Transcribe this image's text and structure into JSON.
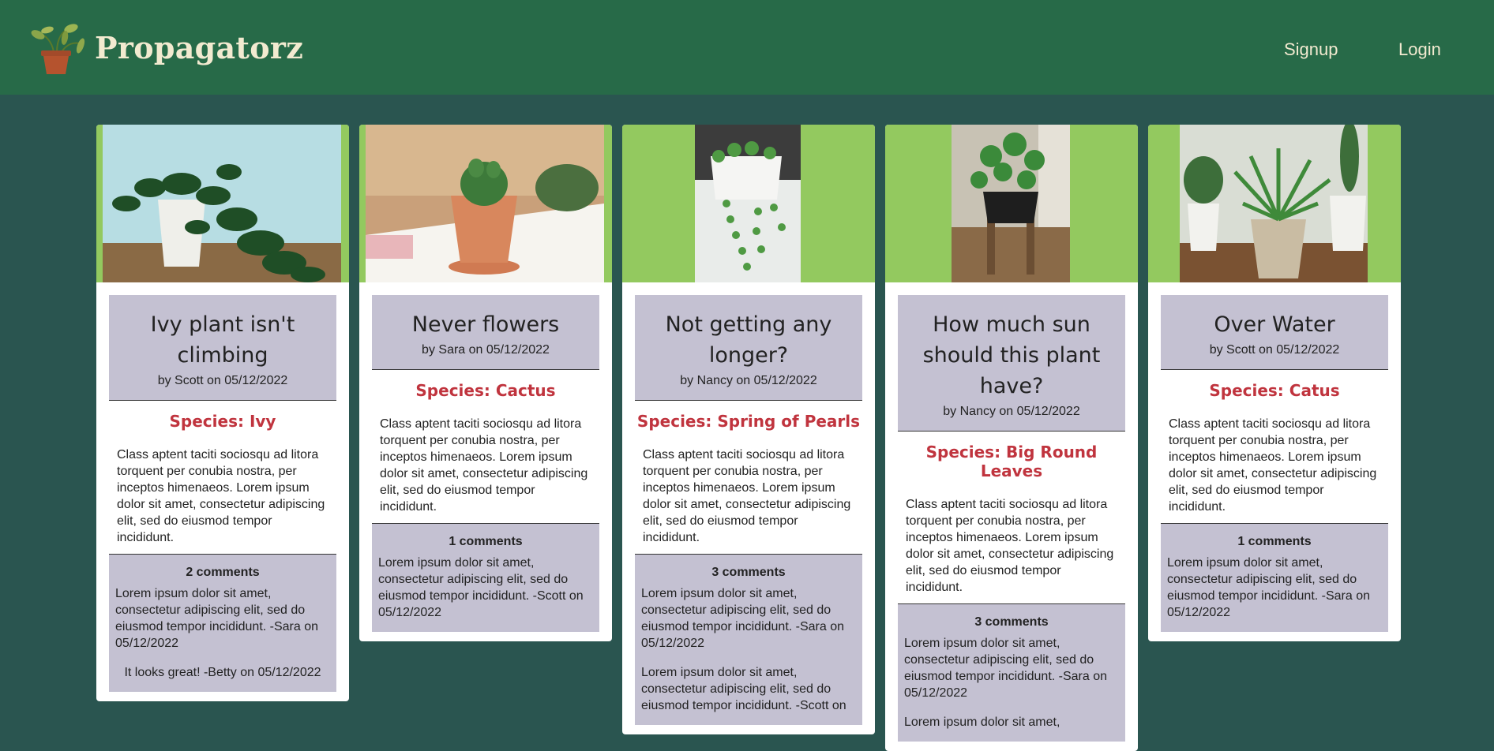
{
  "brand": "Propagatorz",
  "nav": {
    "signup": "Signup",
    "login": "Login"
  },
  "colors": {
    "navbar": "#276a48",
    "background": "#2a5550",
    "image_bg": "#93c95f",
    "box": "#c4c1d2",
    "species": "#c0343e",
    "brand_text": "#f2ead0"
  },
  "posts": [
    {
      "title": "Ivy plant isn't climbing",
      "author": "by Scott on 05/12/2022",
      "species": "Species: Ivy",
      "description": "Class aptent taciti sociosqu ad litora torquent per conubia nostra, per inceptos himenaeos. Lorem ipsum dolor sit amet, consectetur adipiscing elit, sed do eiusmod tempor incididunt.",
      "comment_count": "2 comments",
      "comments": [
        "Lorem ipsum dolor sit amet, consectetur adipiscing elit, sed do eiusmod tempor incididunt. -Sara on 05/12/2022",
        "It looks great! -Betty on 05/12/2022"
      ]
    },
    {
      "title": "Never flowers",
      "author": "by Sara on 05/12/2022",
      "species": "Species: Cactus",
      "description": "Class aptent taciti sociosqu ad litora torquent per conubia nostra, per inceptos himenaeos. Lorem ipsum dolor sit amet, consectetur adipiscing elit, sed do eiusmod tempor incididunt.",
      "comment_count": "1 comments",
      "comments": [
        "Lorem ipsum dolor sit amet, consectetur adipiscing elit, sed do eiusmod tempor incididunt. -Scott on 05/12/2022"
      ]
    },
    {
      "title": "Not getting any longer?",
      "author": "by Nancy on 05/12/2022",
      "species": "Species: Spring of Pearls",
      "description": "Class aptent taciti sociosqu ad litora torquent per conubia nostra, per inceptos himenaeos. Lorem ipsum dolor sit amet, consectetur adipiscing elit, sed do eiusmod tempor incididunt.",
      "comment_count": "3 comments",
      "comments": [
        "Lorem ipsum dolor sit amet, consectetur adipiscing elit, sed do eiusmod tempor incididunt. -Sara on 05/12/2022",
        "Lorem ipsum dolor sit amet, consectetur adipiscing elit, sed do eiusmod tempor incididunt. -Scott on"
      ]
    },
    {
      "title": "How much sun should this plant have?",
      "author": "by Nancy on 05/12/2022",
      "species": "Species: Big Round Leaves",
      "description": "Class aptent taciti sociosqu ad litora torquent per conubia nostra, per inceptos himenaeos. Lorem ipsum dolor sit amet, consectetur adipiscing elit, sed do eiusmod tempor incididunt.",
      "comment_count": "3 comments",
      "comments": [
        "Lorem ipsum dolor sit amet, consectetur adipiscing elit, sed do eiusmod tempor incididunt. -Sara on 05/12/2022",
        "Lorem ipsum dolor sit amet,"
      ]
    },
    {
      "title": "Over Water",
      "author": "by Scott on 05/12/2022",
      "species": "Species: Catus",
      "description": "Class aptent taciti sociosqu ad litora torquent per conubia nostra, per inceptos himenaeos. Lorem ipsum dolor sit amet, consectetur adipiscing elit, sed do eiusmod tempor incididunt.",
      "comment_count": "1 comments",
      "comments": [
        "Lorem ipsum dolor sit amet, consectetur adipiscing elit, sed do eiusmod tempor incididunt. -Sara on 05/12/2022"
      ]
    }
  ]
}
